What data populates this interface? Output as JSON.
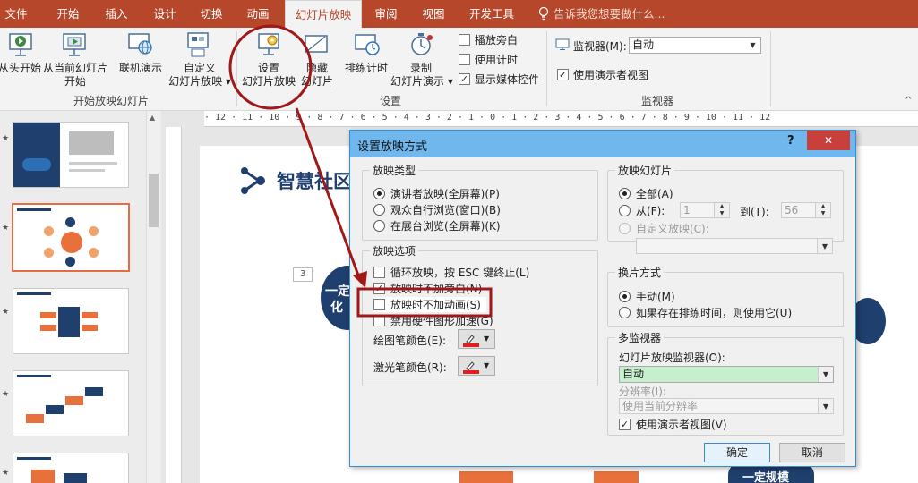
{
  "menubar": {
    "tabs": [
      "文件",
      "开始",
      "插入",
      "设计",
      "切换",
      "动画",
      "幻灯片放映",
      "审阅",
      "视图",
      "开发工具"
    ],
    "active_tab": "幻灯片放映",
    "tell_me": "告诉我您想要做什么..."
  },
  "ribbon": {
    "from_beginning": "从头开始",
    "from_current_1": "从当前幻灯片",
    "from_current_2": "开始",
    "online_present": "联机演示",
    "custom_show_1": "自定义",
    "custom_show_2": "幻灯片放映",
    "group_start": "开始放映幻灯片",
    "setup_show_1": "设置",
    "setup_show_2": "幻灯片放映",
    "hide_slide_1": "隐藏",
    "hide_slide_2": "幻灯片",
    "rehearse": "排练计时",
    "record_1": "录制",
    "record_2": "幻灯片演示",
    "play_narrations": "播放旁白",
    "use_timings": "使用计时",
    "show_media": "显示媒体控件",
    "group_setup": "设置",
    "monitor_label": "监视器(M):",
    "monitor_value": "自动",
    "presenter_view": "使用演示者视图",
    "group_monitors": "监视器"
  },
  "ruler": {
    "text": "· 12 · 11 · 10 · 9 · 8 · 7 · 6 · 5 · 4 · 3 · 2 · 1 · 0 · 1 · 2 · 3 · 4 · 5 · 6 · 7 · 8 · 9 · 10 · 11 · 12"
  },
  "slide": {
    "title": "智慧社区",
    "page_num": "3",
    "circle_text_1": "一定",
    "circle_text_2": "化",
    "bottom_text": "一定规模"
  },
  "dialog": {
    "title": "设置放映方式",
    "help": "?",
    "close": "✕",
    "show_type": {
      "legend": "放映类型",
      "opt1": "演讲者放映(全屏幕)(P)",
      "opt2": "观众自行浏览(窗口)(B)",
      "opt3": "在展台浏览(全屏幕)(K)"
    },
    "show_options": {
      "legend": "放映选项",
      "loop": "循环放映，按 ESC 键终止(L)",
      "no_narration": "放映时不加旁白(N)",
      "no_animation": "放映时不加动画(S)",
      "no_hw_accel": "禁用硬件图形加速(G)",
      "pen_color": "绘图笔颜色(E):",
      "laser_color": "激光笔颜色(R):",
      "pen_hex": "#e02020",
      "laser_hex": "#e02020"
    },
    "show_slides": {
      "legend": "放映幻灯片",
      "all": "全部(A)",
      "from": "从(F):",
      "from_value": "1",
      "to": "到(T):",
      "to_value": "56",
      "custom": "自定义放映(C):"
    },
    "advance": {
      "legend": "换片方式",
      "manual": "手动(M)",
      "timings": "如果存在排练时间，则使用它(U)"
    },
    "multi_monitor": {
      "legend": "多监视器",
      "monitor_label": "幻灯片放映监视器(O):",
      "monitor_value": "自动",
      "resolution_label": "分辨率(I):",
      "resolution_value": "使用当前分辨率",
      "presenter": "使用演示者视图(V)"
    },
    "ok": "确定",
    "cancel": "取消"
  },
  "colors": {
    "accent": "#b7472a",
    "dialog_title": "#70b7ed",
    "annotation": "#a01818",
    "slide_navy": "#1f3f6e",
    "slide_orange": "#e8703a"
  }
}
